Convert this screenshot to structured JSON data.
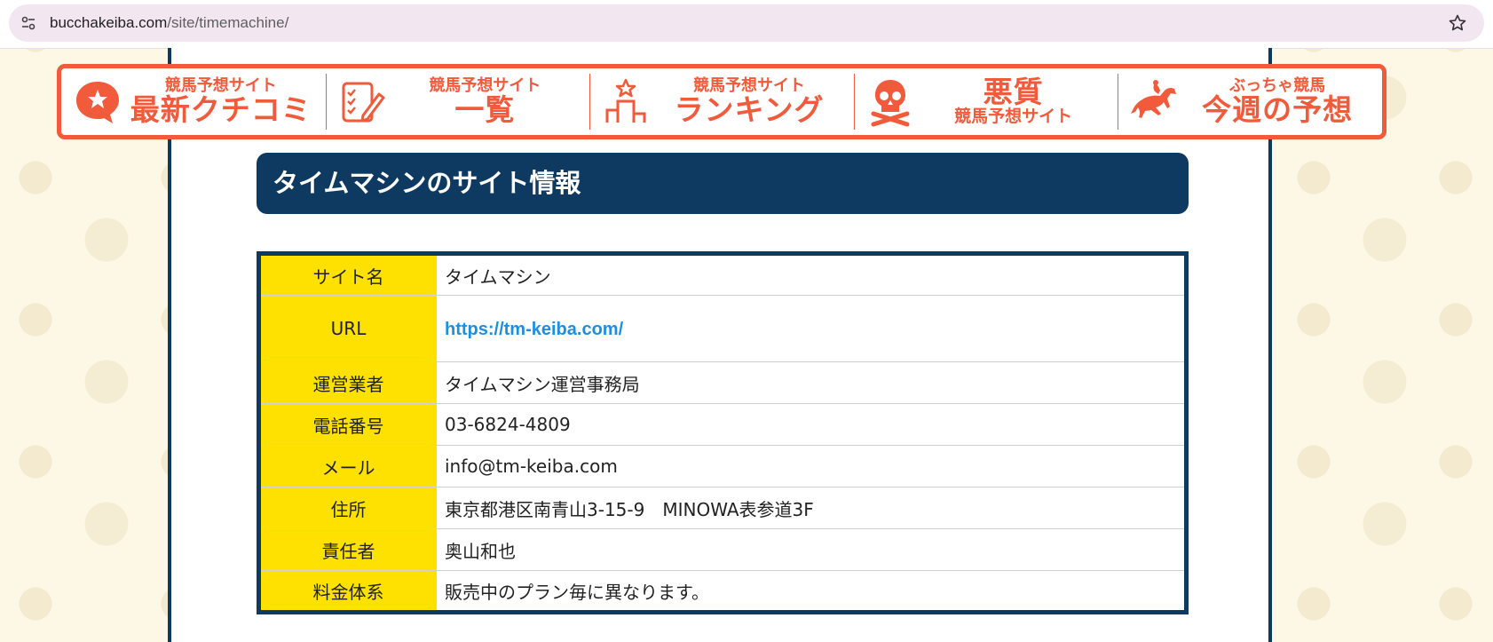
{
  "browser": {
    "url_domain": "bucchakeiba.com",
    "url_path": "/site/timemachine/"
  },
  "nav": [
    {
      "small": "競馬予想サイト",
      "big": "最新クチコミ",
      "icon": "speech-star-icon"
    },
    {
      "small": "競馬予想サイト",
      "big": "一覧",
      "icon": "checklist-pencil-icon"
    },
    {
      "small": "競馬予想サイト",
      "big": "ランキング",
      "icon": "ranking-podium-icon"
    },
    {
      "big": "悪質",
      "small": "競馬予想サイト",
      "icon": "skull-crossbones-icon"
    },
    {
      "small": "ぶっちゃ競馬",
      "big": "今週の予想",
      "icon": "racehorse-icon"
    }
  ],
  "heading": "タイムマシンのサイト情報",
  "table": [
    {
      "label": "サイト名",
      "value": "タイムマシン"
    },
    {
      "label": "URL",
      "value": "https://tm-keiba.com/"
    },
    {
      "label": "運営業者",
      "value": "タイムマシン運営事務局"
    },
    {
      "label": "電話番号",
      "value": "03-6824-4809"
    },
    {
      "label": "メール",
      "value": "info@tm-keiba.com"
    },
    {
      "label": "住所",
      "value": "東京都港区南青山3-15-9　MINOWA表参道3F"
    },
    {
      "label": "責任者",
      "value": "奥山和也"
    },
    {
      "label": "料金体系",
      "value": "販売中のプラン毎に異なります。"
    }
  ],
  "colors": {
    "navy": "#0e3a62",
    "accent": "#f15a3a",
    "label_bg": "#ffe100",
    "link": "#1e8fe0"
  }
}
